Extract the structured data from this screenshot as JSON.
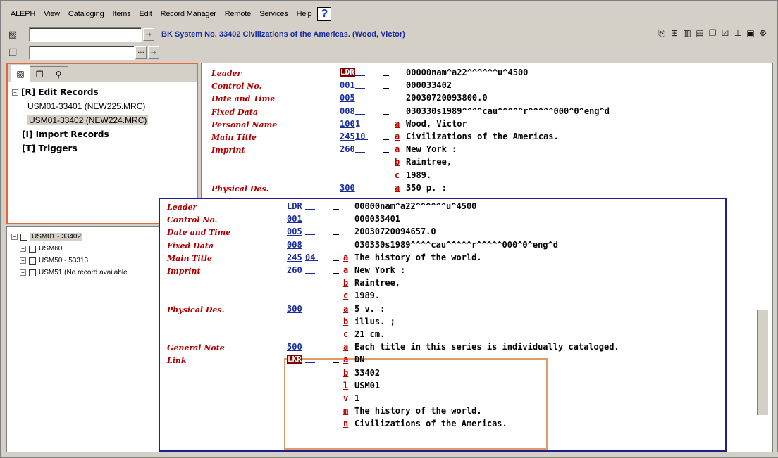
{
  "menu": {
    "items": [
      "ALEPH",
      "View",
      "Cataloging",
      "Items",
      "Edit",
      "Record Manager",
      "Remote",
      "Services",
      "Help"
    ],
    "help_icon": "?"
  },
  "toolbar": {
    "system_title": "BK System No. 33402 Civilizations of the Americas. (Wood, Victor)",
    "search_value": "",
    "record_value": ""
  },
  "left_nav": {
    "tree": [
      {
        "label": "[R] Edit Records",
        "bold": true,
        "expander": "−"
      },
      {
        "label": "USM01-33401 (NEW225.MRC)",
        "bold": false
      },
      {
        "label": "USM01-33402 (NEW224.MRC)",
        "bold": false,
        "selected": true
      },
      {
        "label": "[I] Import Records",
        "bold": true
      },
      {
        "label": "[T] Triggers",
        "bold": true
      }
    ]
  },
  "db_tree": {
    "root": "USM01 - 33402",
    "children": [
      "USM60",
      "USM50 - 53313",
      "USM51 (No record available"
    ]
  },
  "record_main": {
    "fields": [
      {
        "label": "Leader",
        "tag": "LDR",
        "ind1": "",
        "ind2": "",
        "subfields": [
          {
            "code": "",
            "value": "00000nam^a22^^^^^^u^4500"
          }
        ]
      },
      {
        "label": "Control No.",
        "tag": "001",
        "subfields": [
          {
            "code": "",
            "value": "000033402"
          }
        ]
      },
      {
        "label": "Date and Time",
        "tag": "005",
        "subfields": [
          {
            "code": "",
            "value": "20030720093800.0"
          }
        ]
      },
      {
        "label": "Fixed Data",
        "tag": "008",
        "subfields": [
          {
            "code": "",
            "value": "030330s1989^^^^cau^^^^^r^^^^^000^0^eng^d"
          }
        ]
      },
      {
        "label": "Personal Name",
        "tag": "100",
        "ind1": "1",
        "subfields": [
          {
            "code": "a",
            "value": "Wood, Victor"
          }
        ]
      },
      {
        "label": "Main Title",
        "tag": "245",
        "ind1": "10",
        "subfields": [
          {
            "code": "a",
            "value": "Civilizations of the Americas."
          }
        ]
      },
      {
        "label": "Imprint",
        "tag": "260",
        "subfields": [
          {
            "code": "a",
            "value": "New York :"
          },
          {
            "code": "b",
            "value": "Raintree,"
          },
          {
            "code": "c",
            "value": "1989."
          }
        ]
      },
      {
        "label": "Physical Des.",
        "tag": "300",
        "subfields": [
          {
            "code": "a",
            "value": "350 p. :"
          }
        ]
      }
    ]
  },
  "record_popup": {
    "fields": [
      {
        "label": "Leader",
        "tag": "LDR",
        "subfields": [
          {
            "code": "",
            "value": "00000nam^a22^^^^^^u^4500"
          }
        ]
      },
      {
        "label": "Control No.",
        "tag": "001",
        "subfields": [
          {
            "code": "",
            "value": "000033401"
          }
        ]
      },
      {
        "label": "Date and Time",
        "tag": "005",
        "subfields": [
          {
            "code": "",
            "value": "20030720094657.0"
          }
        ]
      },
      {
        "label": "Fixed Data",
        "tag": "008",
        "subfields": [
          {
            "code": "",
            "value": "030330s1989^^^^cau^^^^^r^^^^^000^0^eng^d"
          }
        ]
      },
      {
        "label": "Main Title",
        "tag": "245",
        "ind1": "04",
        "subfields": [
          {
            "code": "a",
            "value": "The history of the world."
          }
        ]
      },
      {
        "label": "Imprint",
        "tag": "260",
        "subfields": [
          {
            "code": "a",
            "value": "New York :"
          },
          {
            "code": "b",
            "value": "Raintree,"
          },
          {
            "code": "c",
            "value": "1989."
          }
        ]
      },
      {
        "label": "Physical Des.",
        "tag": "300",
        "subfields": [
          {
            "code": "a",
            "value": "5 v. :"
          },
          {
            "code": "b",
            "value": "illus. ;"
          },
          {
            "code": "c",
            "value": "21 cm."
          }
        ]
      },
      {
        "label": "General Note",
        "tag": "500",
        "subfields": [
          {
            "code": "a",
            "value": "Each title in this series is individually cataloged."
          }
        ]
      },
      {
        "label": "Link",
        "tag": "LKR",
        "subfields": [
          {
            "code": "a",
            "value": "DN"
          },
          {
            "code": "b",
            "value": "33402"
          },
          {
            "code": "l",
            "value": "USM01"
          },
          {
            "code": "v",
            "value": "1"
          },
          {
            "code": "m",
            "value": "The history of the world."
          },
          {
            "code": "n",
            "value": "Civilizations of the Americas."
          }
        ]
      }
    ]
  },
  "colors": {
    "field_label": "#b20000",
    "tag_blue": "#1a2d9c",
    "ldr_box": "#800000",
    "popup_border": "#1f1f8c",
    "highlight_orange": "#e3693b"
  }
}
